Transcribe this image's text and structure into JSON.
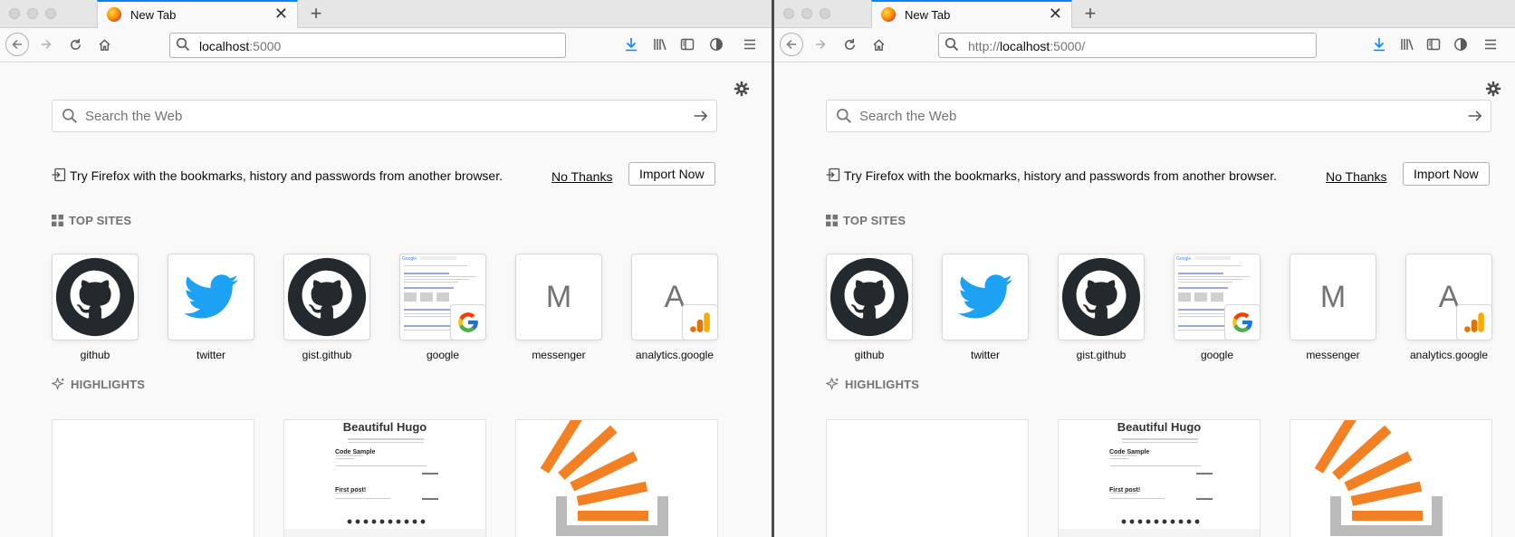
{
  "windows": [
    {
      "id": "left",
      "tab": {
        "title": "New Tab",
        "close_icon": "close-icon"
      },
      "url": {
        "host": "localhost",
        "rest": ":5000",
        "prefix": ""
      },
      "search": {
        "placeholder": "Search the Web"
      },
      "notice": {
        "text": "Try Firefox with the bookmarks, history and passwords from another browser.",
        "no_thanks": "No Thanks",
        "import_now": "Import Now"
      },
      "top_sites_heading": "TOP SITES",
      "top_sites": [
        {
          "label": "github",
          "icon": "github-icon"
        },
        {
          "label": "twitter",
          "icon": "twitter-icon"
        },
        {
          "label": "gist.github",
          "icon": "github-icon"
        },
        {
          "label": "google",
          "icon": "google-icon"
        },
        {
          "label": "messenger",
          "icon": "letter",
          "letter": "M"
        },
        {
          "label": "analytics.google",
          "icon": "letter",
          "letter": "A"
        }
      ],
      "highlights_heading": "HIGHLIGHTS",
      "highlights": [
        {
          "kind": "blank"
        },
        {
          "kind": "hugo",
          "title": "Beautiful Hugo",
          "items": [
            "Code Sample",
            "First post!"
          ]
        },
        {
          "kind": "stackoverflow"
        }
      ]
    },
    {
      "id": "right",
      "tab": {
        "title": "New Tab",
        "close_icon": "close-icon"
      },
      "url": {
        "host": "localhost",
        "rest": ":5000/",
        "prefix": "http://"
      },
      "search": {
        "placeholder": "Search the Web"
      },
      "notice": {
        "text": "Try Firefox with the bookmarks, history and passwords from another browser.",
        "no_thanks": "No Thanks",
        "import_now": "Import Now"
      },
      "top_sites_heading": "TOP SITES",
      "top_sites": [
        {
          "label": "github",
          "icon": "github-icon"
        },
        {
          "label": "twitter",
          "icon": "twitter-icon"
        },
        {
          "label": "gist.github",
          "icon": "github-icon"
        },
        {
          "label": "google",
          "icon": "google-icon"
        },
        {
          "label": "messenger",
          "icon": "letter",
          "letter": "M"
        },
        {
          "label": "analytics.google",
          "icon": "letter",
          "letter": "A"
        }
      ],
      "highlights_heading": "HIGHLIGHTS",
      "highlights": [
        {
          "kind": "blank"
        },
        {
          "kind": "hugo",
          "title": "Beautiful Hugo",
          "items": [
            "Code Sample",
            "First post!"
          ]
        },
        {
          "kind": "stackoverflow"
        }
      ]
    }
  ],
  "colors": {
    "accent": "#0a84ff",
    "download": "#0a84ff",
    "github_black": "#24292e",
    "twitter_blue": "#1da1f2",
    "stack_orange": "#f48024"
  }
}
